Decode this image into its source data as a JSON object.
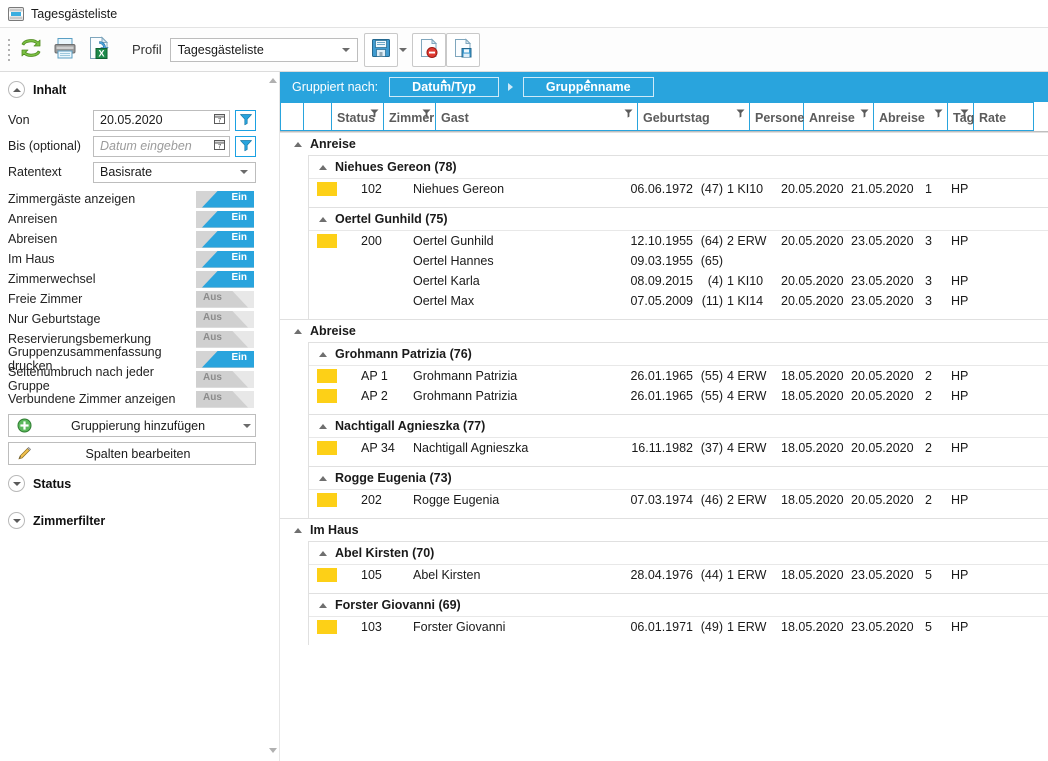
{
  "window": {
    "tab_title": "Tagesgästeliste",
    "tab_icon": "window-tab-icon"
  },
  "toolbar": {
    "refresh_label": "refresh-icon",
    "print_label": "print-icon",
    "excel_label": "export-excel-icon",
    "profil_label": "Profil",
    "profil_value": "Tagesgästeliste",
    "save_label": "save-icon",
    "delete_label": "delete-profile-icon",
    "saveas_label": "save-as-profile-icon"
  },
  "sidebar": {
    "inhalt": {
      "title": "Inhalt",
      "von_label": "Von",
      "von_value": "20.05.2020",
      "bis_label": "Bis (optional)",
      "bis_value": "",
      "bis_placeholder": "Datum eingeben",
      "ratentext_label": "Ratentext",
      "ratentext_value": "Basisrate",
      "on_label": "Ein",
      "off_label": "Aus",
      "toggles": [
        {
          "label": "Zimmergäste anzeigen",
          "state": "Ein"
        },
        {
          "label": "Anreisen",
          "state": "Ein"
        },
        {
          "label": "Abreisen",
          "state": "Ein"
        },
        {
          "label": "Im Haus",
          "state": "Ein"
        },
        {
          "label": "Zimmerwechsel",
          "state": "Ein"
        },
        {
          "label": "Freie Zimmer",
          "state": "Aus"
        },
        {
          "label": "Nur Geburtstage",
          "state": "Aus"
        },
        {
          "label": "Reservierungsbemerkung",
          "state": "Aus"
        },
        {
          "label": "Gruppenzusammenfassung drucken",
          "state": "Ein"
        },
        {
          "label": "Seitenumbruch nach jeder Gruppe",
          "state": "Aus"
        },
        {
          "label": "Verbundene Zimmer anzeigen",
          "state": "Aus"
        }
      ],
      "add_grouping_label": "Gruppierung hinzufügen",
      "edit_columns_label": "Spalten bearbeiten"
    },
    "status_section": "Status",
    "zimmerfilter_section": "Zimmerfilter"
  },
  "grid": {
    "grouped_by_label": "Gruppiert nach:",
    "group_chips": [
      "Datum/Typ",
      "Gruppenname"
    ],
    "columns": [
      {
        "label": "",
        "filter": false
      },
      {
        "label": "",
        "filter": false
      },
      {
        "label": "Status",
        "filter": true
      },
      {
        "label": "Zimmer",
        "filter": true
      },
      {
        "label": "Gast",
        "filter": true
      },
      {
        "label": "Geburtstag",
        "filter": true
      },
      {
        "label": "Personen",
        "filter": false
      },
      {
        "label": "Anreise",
        "filter": true
      },
      {
        "label": "Abreise",
        "filter": true
      },
      {
        "label": "Tage",
        "filter": true
      },
      {
        "label": "Rate",
        "filter": false
      }
    ],
    "groups": [
      {
        "title": "Anreise",
        "subgroups": [
          {
            "title": "Niehues Gereon (78)",
            "rows": [
              {
                "status": "yellow",
                "zimmer": "102",
                "gast": "Niehues Gereon",
                "geburtstag": "06.06.1972",
                "alter": "(47)",
                "personen": "1 KI10",
                "anreise": "20.05.2020",
                "abreise": "21.05.2020",
                "tage": "1",
                "rate": "HP"
              }
            ]
          },
          {
            "title": "Oertel Gunhild (75)",
            "rows": [
              {
                "status": "yellow",
                "zimmer": "200",
                "gast": "Oertel Gunhild",
                "geburtstag": "12.10.1955",
                "alter": "(64)",
                "personen": "2 ERW",
                "anreise": "20.05.2020",
                "abreise": "23.05.2020",
                "tage": "3",
                "rate": "HP"
              },
              {
                "status": "",
                "zimmer": "",
                "gast": "Oertel Hannes",
                "geburtstag": "09.03.1955",
                "alter": "(65)",
                "personen": "",
                "anreise": "",
                "abreise": "",
                "tage": "",
                "rate": ""
              },
              {
                "status": "",
                "zimmer": "",
                "gast": "Oertel Karla",
                "geburtstag": "08.09.2015",
                "alter": "(4)",
                "personen": "1 KI10",
                "anreise": "20.05.2020",
                "abreise": "23.05.2020",
                "tage": "3",
                "rate": "HP"
              },
              {
                "status": "",
                "zimmer": "",
                "gast": "Oertel Max",
                "geburtstag": "07.05.2009",
                "alter": "(11)",
                "personen": "1 KI14",
                "anreise": "20.05.2020",
                "abreise": "23.05.2020",
                "tage": "3",
                "rate": "HP"
              }
            ]
          }
        ]
      },
      {
        "title": "Abreise",
        "subgroups": [
          {
            "title": "Grohmann Patrizia (76)",
            "rows": [
              {
                "status": "yellow",
                "zimmer": "AP 1",
                "gast": "Grohmann Patrizia",
                "geburtstag": "26.01.1965",
                "alter": "(55)",
                "personen": "4 ERW",
                "anreise": "18.05.2020",
                "abreise": "20.05.2020",
                "tage": "2",
                "rate": "HP"
              },
              {
                "status": "yellow",
                "zimmer": "AP 2",
                "gast": "Grohmann Patrizia",
                "geburtstag": "26.01.1965",
                "alter": "(55)",
                "personen": "4 ERW",
                "anreise": "18.05.2020",
                "abreise": "20.05.2020",
                "tage": "2",
                "rate": "HP"
              }
            ]
          },
          {
            "title": "Nachtigall Agnieszka (77)",
            "rows": [
              {
                "status": "yellow",
                "zimmer": "AP 34",
                "gast": "Nachtigall Agnieszka",
                "geburtstag": "16.11.1982",
                "alter": "(37)",
                "personen": "4 ERW",
                "anreise": "18.05.2020",
                "abreise": "20.05.2020",
                "tage": "2",
                "rate": "HP"
              }
            ]
          },
          {
            "title": "Rogge Eugenia (73)",
            "rows": [
              {
                "status": "yellow",
                "zimmer": "202",
                "gast": "Rogge Eugenia",
                "geburtstag": "07.03.1974",
                "alter": "(46)",
                "personen": "2 ERW",
                "anreise": "18.05.2020",
                "abreise": "20.05.2020",
                "tage": "2",
                "rate": "HP"
              }
            ]
          }
        ]
      },
      {
        "title": "Im Haus",
        "subgroups": [
          {
            "title": "Abel Kirsten (70)",
            "rows": [
              {
                "status": "yellow",
                "zimmer": "105",
                "gast": "Abel Kirsten",
                "geburtstag": "28.04.1976",
                "alter": "(44)",
                "personen": "1 ERW",
                "anreise": "18.05.2020",
                "abreise": "23.05.2020",
                "tage": "5",
                "rate": "HP"
              }
            ]
          },
          {
            "title": "Forster Giovanni (69)",
            "rows": [
              {
                "status": "yellow",
                "zimmer": "103",
                "gast": "Forster Giovanni",
                "geburtstag": "06.01.1971",
                "alter": "(49)",
                "personen": "1 ERW",
                "anreise": "18.05.2020",
                "abreise": "23.05.2020",
                "tage": "5",
                "rate": "HP"
              }
            ]
          }
        ]
      }
    ]
  },
  "colors": {
    "accent": "#29a4dd",
    "status_yellow": "#fdd017",
    "toggle_on": "#29a4dd",
    "toggle_off": "#d0d0d0"
  }
}
